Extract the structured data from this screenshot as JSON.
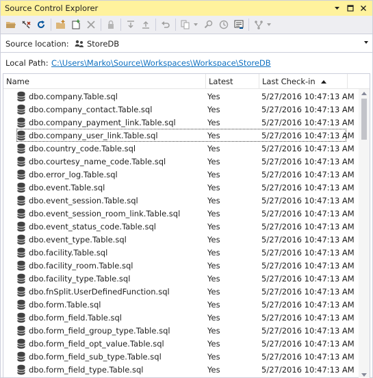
{
  "window": {
    "title": "Source Control Explorer"
  },
  "toolbar": {
    "icons": [
      "open-folder-icon",
      "disconnect-icon",
      "refresh-icon",
      "new-folder-icon",
      "add-items-icon",
      "delete-icon",
      "lock-icon",
      "get-latest-icon",
      "check-in-icon",
      "undo-icon",
      "compare-icon",
      "find-icon",
      "history-icon",
      "workspace-icon",
      "branch-icon"
    ]
  },
  "source_location": {
    "label": "Source location:",
    "value": "StoreDB"
  },
  "local_path": {
    "label": "Local Path:",
    "value": "C:\\Users\\Marko\\Source\\Workspaces\\Workspace\\StoreDB"
  },
  "columns": {
    "name": "Name",
    "latest": "Latest",
    "last_checkin": "Last Check-in"
  },
  "files": [
    {
      "name": "dbo.company.Table.sql",
      "latest": "Yes",
      "checkin": "5/27/2016 10:47:13 AM"
    },
    {
      "name": "dbo.company_contact.Table.sql",
      "latest": "Yes",
      "checkin": "5/27/2016 10:47:13 AM"
    },
    {
      "name": "dbo.company_payment_link.Table.sql",
      "latest": "Yes",
      "checkin": "5/27/2016 10:47:13 AM"
    },
    {
      "name": "dbo.company_user_link.Table.sql",
      "latest": "Yes",
      "checkin": "5/27/2016 10:47:13 AM"
    },
    {
      "name": "dbo.country_code.Table.sql",
      "latest": "Yes",
      "checkin": "5/27/2016 10:47:13 AM"
    },
    {
      "name": "dbo.courtesy_name_code.Table.sql",
      "latest": "Yes",
      "checkin": "5/27/2016 10:47:13 AM"
    },
    {
      "name": "dbo.error_log.Table.sql",
      "latest": "Yes",
      "checkin": "5/27/2016 10:47:13 AM"
    },
    {
      "name": "dbo.event.Table.sql",
      "latest": "Yes",
      "checkin": "5/27/2016 10:47:13 AM"
    },
    {
      "name": "dbo.event_session.Table.sql",
      "latest": "Yes",
      "checkin": "5/27/2016 10:47:13 AM"
    },
    {
      "name": "dbo.event_session_room_link.Table.sql",
      "latest": "Yes",
      "checkin": "5/27/2016 10:47:13 AM"
    },
    {
      "name": "dbo.event_status_code.Table.sql",
      "latest": "Yes",
      "checkin": "5/27/2016 10:47:13 AM"
    },
    {
      "name": "dbo.event_type.Table.sql",
      "latest": "Yes",
      "checkin": "5/27/2016 10:47:13 AM"
    },
    {
      "name": "dbo.facility.Table.sql",
      "latest": "Yes",
      "checkin": "5/27/2016 10:47:13 AM"
    },
    {
      "name": "dbo.facility_room.Table.sql",
      "latest": "Yes",
      "checkin": "5/27/2016 10:47:13 AM"
    },
    {
      "name": "dbo.facility_type.Table.sql",
      "latest": "Yes",
      "checkin": "5/27/2016 10:47:13 AM"
    },
    {
      "name": "dbo.fnSplit.UserDefinedFunction.sql",
      "latest": "Yes",
      "checkin": "5/27/2016 10:47:13 AM"
    },
    {
      "name": "dbo.form.Table.sql",
      "latest": "Yes",
      "checkin": "5/27/2016 10:47:13 AM"
    },
    {
      "name": "dbo.form_field.Table.sql",
      "latest": "Yes",
      "checkin": "5/27/2016 10:47:13 AM"
    },
    {
      "name": "dbo.form_field_group_type.Table.sql",
      "latest": "Yes",
      "checkin": "5/27/2016 10:47:13 AM"
    },
    {
      "name": "dbo.form_field_opt_value.Table.sql",
      "latest": "Yes",
      "checkin": "5/27/2016 10:47:13 AM"
    },
    {
      "name": "dbo.form_field_sub_type.Table.sql",
      "latest": "Yes",
      "checkin": "5/27/2016 10:47:13 AM"
    },
    {
      "name": "dbo.form_field_type.Table.sql",
      "latest": "Yes",
      "checkin": "5/27/2016 10:47:13 AM"
    }
  ],
  "selected_file": "dbo.company_user_link.Table.sql"
}
